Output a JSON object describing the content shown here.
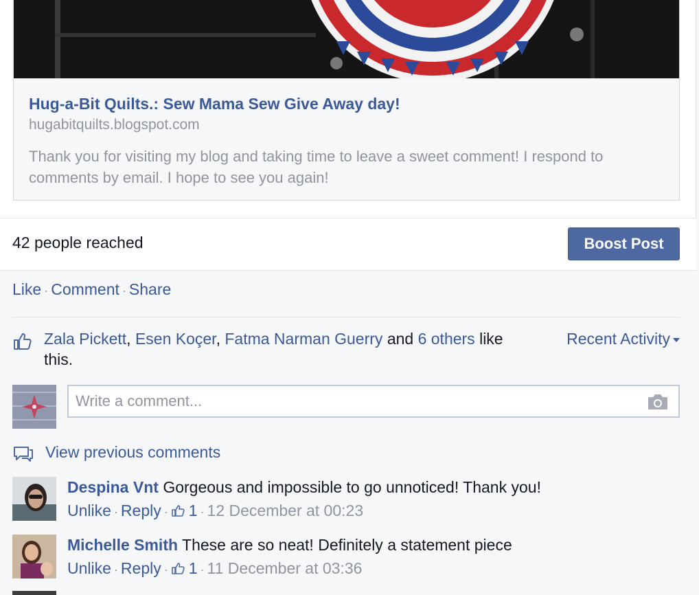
{
  "shared_link": {
    "title": "Hug-a-Bit Quilts.: Sew Mama Sew Give Away day!",
    "domain": "hugabitquilts.blogspot.com",
    "description": "Thank you for visiting my blog and taking time to leave a sweet comment! I respond to comments by email. I hope to see you again!"
  },
  "reach": {
    "text": "42 people reached",
    "boost_label": "Boost Post"
  },
  "actions": {
    "like": "Like",
    "comment": "Comment",
    "share": "Share"
  },
  "likes": {
    "names": [
      "Zala Pickett",
      "Esen Koçer",
      "Fatma Narman Guerry"
    ],
    "and_text": "and",
    "others_link": "6 others",
    "suffix": "like this.",
    "recent_activity": "Recent Activity"
  },
  "comment_box": {
    "placeholder": "Write a comment..."
  },
  "view_previous": "View previous comments",
  "comments": [
    {
      "author": "Despina Vnt",
      "text": "Gorgeous and impossible to go unnoticed! Thank you!",
      "unlike": "Unlike",
      "reply": "Reply",
      "likes": "1",
      "time": "12 December at 00:23"
    },
    {
      "author": "Michelle Smith",
      "text": "These are so neat! Definitely a statement piece",
      "unlike": "Unlike",
      "reply": "Reply",
      "likes": "1",
      "time": "11 December at 03:36"
    }
  ],
  "icons": {
    "like": "thumbs-up-icon",
    "camera": "camera-icon",
    "comments": "speech-bubble-icon",
    "caret": "caret-down-icon"
  },
  "colors": {
    "link": "#3b5998",
    "boost_button": "#4e69a2",
    "muted_text": "#90949c",
    "background": "#f6f7f9"
  }
}
